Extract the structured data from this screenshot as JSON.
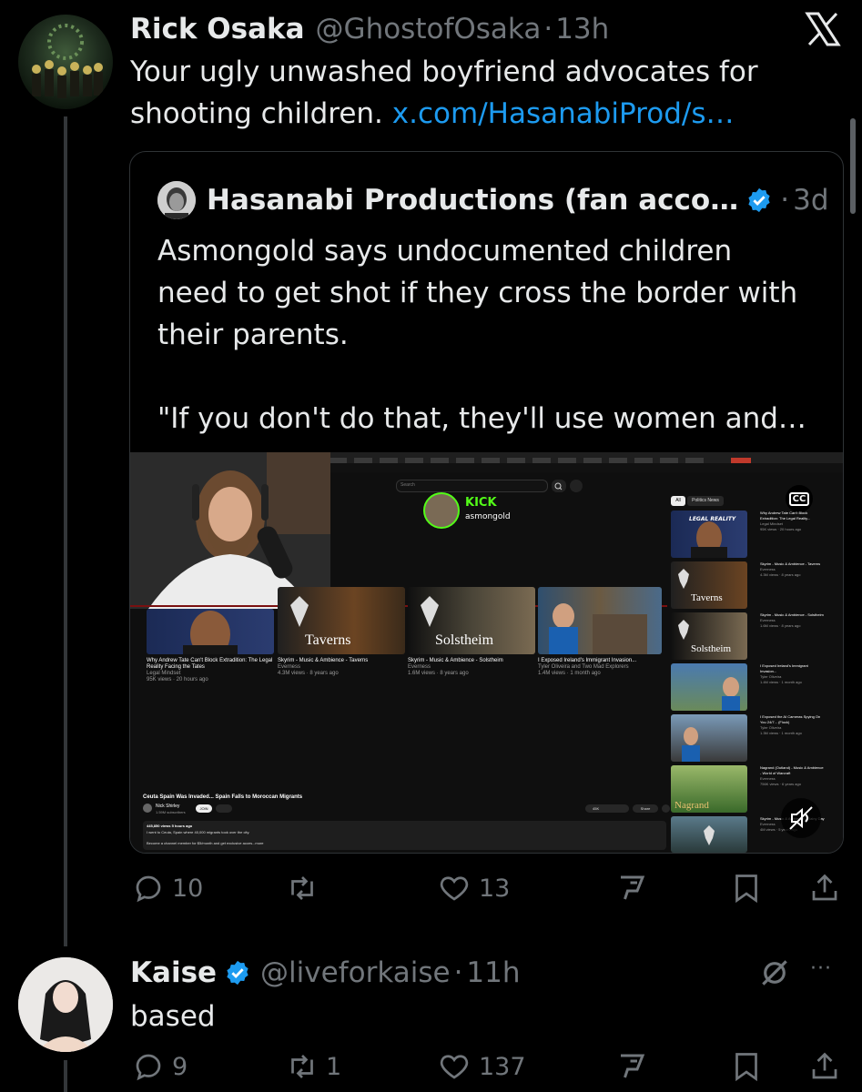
{
  "tweet": {
    "author_name": "Rick Osaka",
    "handle": "@GhostofOsaka",
    "dot": "·",
    "time": "13h",
    "text": "Your ugly unwashed boyfriend advocates for shooting children.",
    "link": "x.com/HasanabiProd/s…"
  },
  "quote": {
    "author_name": "Hasanabi Productions (fan acco…",
    "dot": "·",
    "time": "3d",
    "text_line1": "Asmongold says undocumented children",
    "text_line2": "need to get shot if they cross the border with",
    "text_line3": "their parents.",
    "text_line4": "\"If you don't do that, they'll use women and…"
  },
  "video": {
    "kick_label": "KICK",
    "kick_user": "asmongold",
    "cc_label": "CC",
    "search_placeholder": "Search",
    "chip_all": "All",
    "chip_politics": "Politics News",
    "video_title": "Ceuta Spain Was Invaded... Spain Falls to Moroccan Migrants",
    "channel": "Nick Shirley",
    "subs": "1.59M subscribers",
    "join_label": "JOIN",
    "likes": "45K",
    "share": "Share",
    "views_line": "445,850 views 5 hours ago",
    "desc_line": "I went to Ceuta, Spain where 40,000 migrants took over the city.",
    "member_line": "Become a channel member for $5/month and get exclusive acces...more",
    "grid": [
      {
        "title": "Why Andrew Tate Can't Block Extradition: The Legal Reality Facing the Tates",
        "channel": "Legal Mindset",
        "meta": "95K views · 20 hours ago"
      },
      {
        "title": "Skyrim - Music & Ambience - Taverns",
        "overlay": "Taverns",
        "channel": "Everness",
        "meta": "4.3M views · 8 years ago"
      },
      {
        "title": "Skyrim - Music & Ambience - Solstheim",
        "overlay": "Solstheim",
        "channel": "Everness",
        "meta": "1.6M views · 8 years ago"
      },
      {
        "title": "I Exposed Ireland's Immigrant Invasion...",
        "channel": "Tyler Oliveira and Two Mad Explorers",
        "meta": "1.4M views · 1 month ago"
      }
    ],
    "sidebar": [
      {
        "title": "Why Andrew Tate Can't Block Extradition: The Legal Reality...",
        "channel": "Legal Mindset",
        "meta": "95K views · 20 hours ago",
        "overlay": "LEGAL REALITY"
      },
      {
        "title": "Skyrim - Music & Ambience - Taverns",
        "channel": "Everness",
        "meta": "4.3M views · 8 years ago",
        "overlay": "Taverns"
      },
      {
        "title": "Skyrim - Music & Ambience - Solstheim",
        "channel": "Everness",
        "meta": "1.6M views · 8 years ago",
        "overlay": "Solstheim"
      },
      {
        "title": "I Exposed Ireland's Immigrant Invasion...",
        "channel": "Tyler Oliveira",
        "meta": "1.4M views · 1 month ago",
        "overlay": ""
      },
      {
        "title": "I Exposed the AI Cameras Spying On You 24/7... (Flock)",
        "channel": "Tyler Oliveira",
        "meta": "1.3M views · 1 month ago",
        "overlay": ""
      },
      {
        "title": "Nagrand (Outland) - Music & Ambience - World of Warcraft",
        "channel": "Everness",
        "meta": "756K views · 6 years ago",
        "overlay": "Nagrand"
      },
      {
        "title": "Skyrim - Music & Ambience - Rainy Day",
        "channel": "Everness",
        "meta": "4M views · 5 years ago",
        "overlay": ""
      }
    ]
  },
  "actions1": {
    "reply_count": "10",
    "retweet_count": "",
    "like_count": "13"
  },
  "reply": {
    "author_name": "Kaise",
    "handle": "@liveforkaise",
    "dot": "·",
    "time": "11h",
    "text": "based"
  },
  "actions2": {
    "reply_count": "9",
    "retweet_count": "1",
    "like_count": "137"
  },
  "icons": {
    "x_logo": "X",
    "more": "···"
  },
  "colors": {
    "link": "#1d9bf0",
    "verified": "#1d9bf0",
    "kick_green": "#53fc18",
    "muted": "#71767b"
  }
}
